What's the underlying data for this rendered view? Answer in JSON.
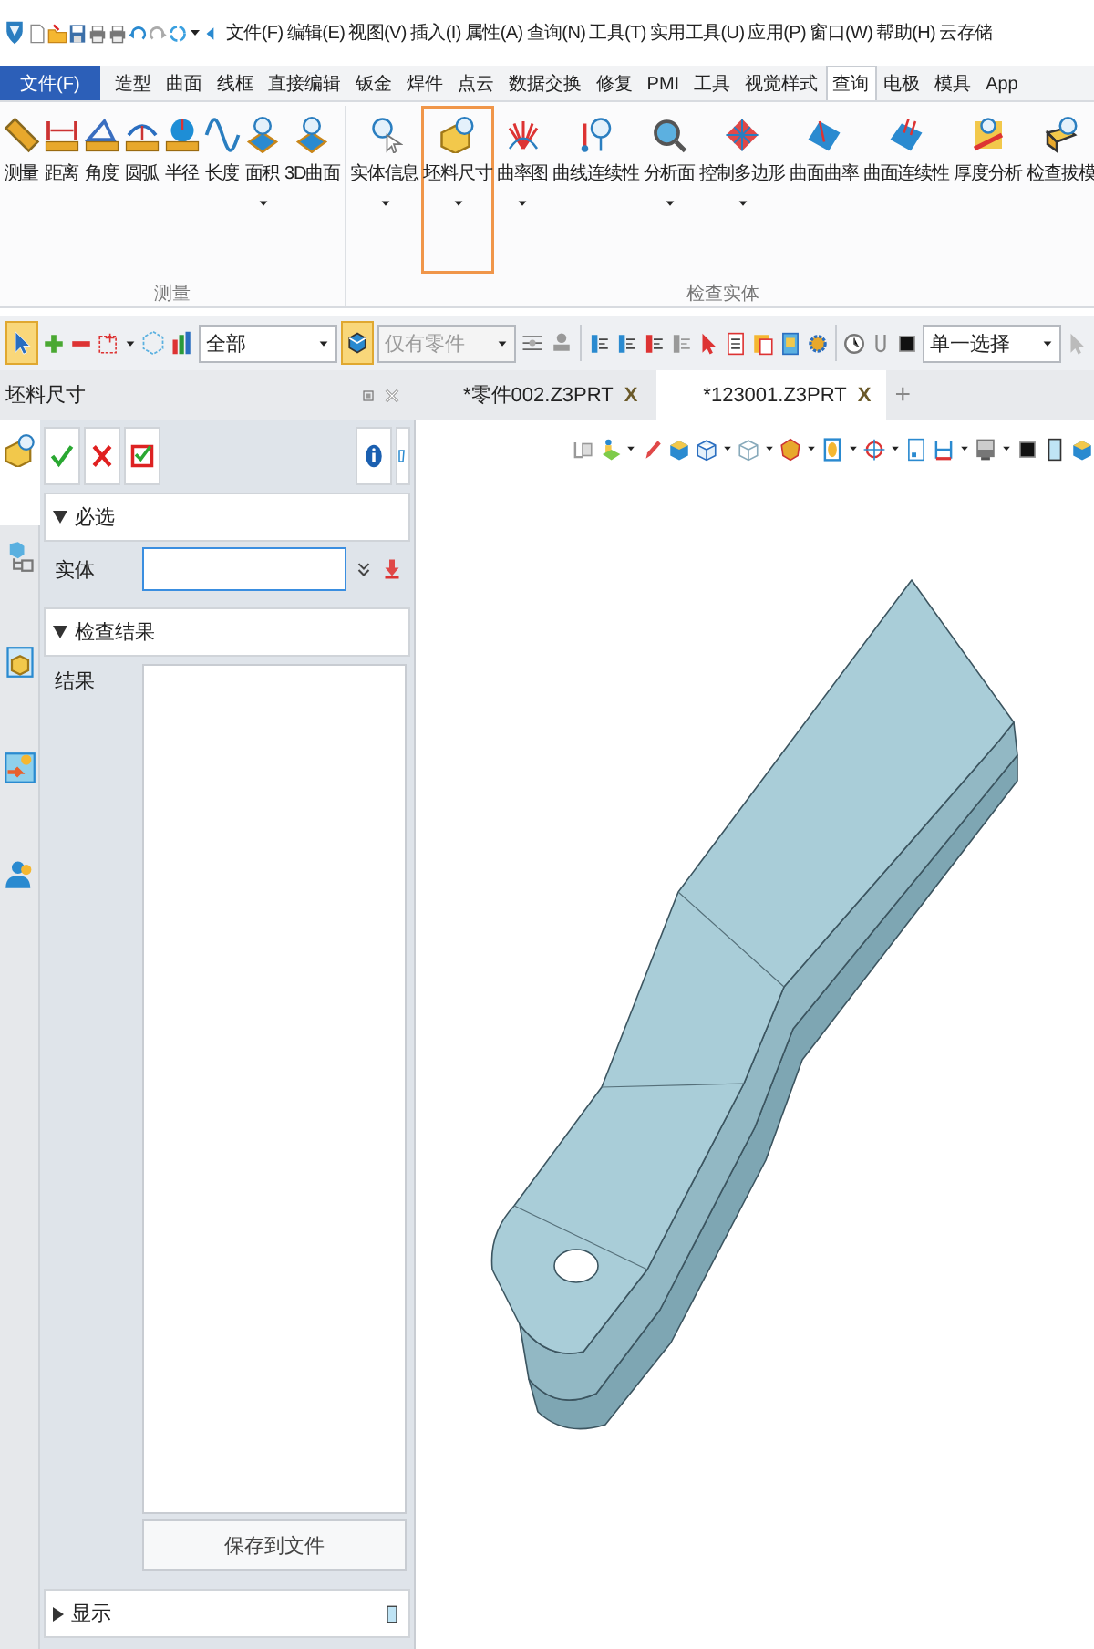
{
  "menu_bar": {
    "items": [
      "文件(F)",
      "编辑(E)",
      "视图(V)",
      "插入(I)",
      "属性(A)",
      "查询(N)",
      "工具(T)",
      "实用工具(U)",
      "应用(P)",
      "窗口(W)",
      "帮助(H)",
      "云存储"
    ]
  },
  "ribbon_tabs": [
    {
      "label": "文件(F)",
      "kind": "app",
      "selected": false
    },
    {
      "label": "造型",
      "kind": "tab",
      "selected": false
    },
    {
      "label": "曲面",
      "kind": "tab",
      "selected": false
    },
    {
      "label": "线框",
      "kind": "tab",
      "selected": false
    },
    {
      "label": "直接编辑",
      "kind": "tab",
      "selected": false
    },
    {
      "label": "钣金",
      "kind": "tab",
      "selected": false
    },
    {
      "label": "焊件",
      "kind": "tab",
      "selected": false
    },
    {
      "label": "点云",
      "kind": "tab",
      "selected": false
    },
    {
      "label": "数据交换",
      "kind": "tab",
      "selected": false
    },
    {
      "label": "修复",
      "kind": "tab",
      "selected": false
    },
    {
      "label": "PMI",
      "kind": "tab",
      "selected": false
    },
    {
      "label": "工具",
      "kind": "tab",
      "selected": false
    },
    {
      "label": "视觉样式",
      "kind": "tab",
      "selected": false
    },
    {
      "label": "查询",
      "kind": "tab",
      "selected": true
    },
    {
      "label": "电极",
      "kind": "tab",
      "selected": false
    },
    {
      "label": "模具",
      "kind": "tab",
      "selected": false
    },
    {
      "label": "App",
      "kind": "tab",
      "selected": false
    }
  ],
  "ribbon_groups": [
    {
      "title": "测量",
      "buttons": [
        {
          "label": "测量",
          "dropdown": false,
          "highlighted": false
        },
        {
          "label": "距离",
          "dropdown": false,
          "highlighted": false
        },
        {
          "label": "角度",
          "dropdown": false,
          "highlighted": false
        },
        {
          "label": "圆弧",
          "dropdown": false,
          "highlighted": false
        },
        {
          "label": "半径",
          "dropdown": false,
          "highlighted": false
        },
        {
          "label": "长度",
          "dropdown": false,
          "highlighted": false
        },
        {
          "label": "面积",
          "dropdown": true,
          "highlighted": false
        },
        {
          "label": "3D曲面",
          "dropdown": false,
          "highlighted": false
        }
      ]
    },
    {
      "title": "检查实体",
      "buttons": [
        {
          "label": "实体信息",
          "dropdown": true,
          "highlighted": false
        },
        {
          "label": "坯料尺寸",
          "dropdown": true,
          "highlighted": true
        },
        {
          "label": "曲率图",
          "dropdown": true,
          "highlighted": false
        },
        {
          "label": "曲线连续性",
          "dropdown": false,
          "highlighted": false
        },
        {
          "label": "分析面",
          "dropdown": true,
          "highlighted": false
        },
        {
          "label": "控制多边形",
          "dropdown": true,
          "highlighted": false
        },
        {
          "label": "曲面曲率",
          "dropdown": false,
          "highlighted": false
        },
        {
          "label": "曲面连续性",
          "dropdown": false,
          "highlighted": false
        },
        {
          "label": "厚度分析",
          "dropdown": false,
          "highlighted": false
        },
        {
          "label": "检查拔模",
          "dropdown": false,
          "highlighted": false
        }
      ]
    }
  ],
  "toolbar": {
    "pick_toggle_pressed": true,
    "filter_combo": {
      "value": "全部",
      "disabled": false
    },
    "part_toggle_pressed": true,
    "part_combo": {
      "value": "仅有零件",
      "disabled": true
    },
    "select_combo": {
      "value": "单一选择",
      "disabled": false
    }
  },
  "panel": {
    "title": "坯料尺寸",
    "sections": [
      {
        "title": "必选",
        "expanded": true,
        "rows": [
          {
            "label": "实体",
            "kind": "input",
            "focused": true
          }
        ]
      },
      {
        "title": "检查结果",
        "expanded": true,
        "rows": [
          {
            "label": "结果",
            "kind": "list",
            "button": "保存到文件"
          }
        ]
      },
      {
        "title": "显示",
        "expanded": false
      }
    ]
  },
  "side_tabs": [
    {
      "selected": true
    },
    {
      "selected": false
    },
    {
      "selected": false
    },
    {
      "selected": false
    },
    {
      "selected": false
    }
  ],
  "doc_tabs": [
    {
      "label": "*零件002.Z3PRT",
      "close": "X",
      "selected": false
    },
    {
      "label": "*123001.Z3PRT",
      "close": "X",
      "selected": true
    }
  ],
  "new_tab": "+"
}
